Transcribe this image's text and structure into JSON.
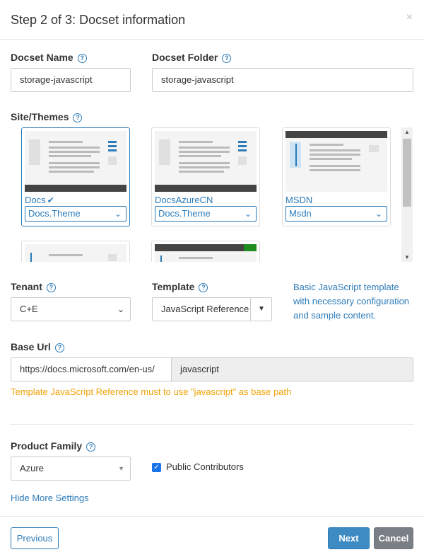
{
  "dialog": {
    "title": "Step 2 of 3: Docset information",
    "close_icon": "×"
  },
  "docset_name": {
    "label": "Docset Name",
    "value": "storage-javascript"
  },
  "docset_folder": {
    "label": "Docset Folder",
    "value": "storage-javascript"
  },
  "themes": {
    "label": "Site/Themes",
    "cards": [
      {
        "name": "Docs",
        "checked_mark": "✔",
        "select": "Docs.Theme",
        "selected": true
      },
      {
        "name": "DocsAzureCN",
        "select": "Docs.Theme"
      },
      {
        "name": "MSDN",
        "select": "Msdn"
      }
    ]
  },
  "tenant": {
    "label": "Tenant",
    "value": "C+E"
  },
  "template": {
    "label": "Template",
    "value": "JavaScript Reference",
    "description": "Basic JavaScript template with necessary configuration and sample content."
  },
  "base_url": {
    "label": "Base Url",
    "prefix": "https://docs.microsoft.com/en-us/",
    "value": "javascript",
    "warning": "Template JavaScript Reference must to use \"javascript\" as base path"
  },
  "product_family": {
    "label": "Product Family",
    "value": "Azure"
  },
  "public_contributors": {
    "label": "Public Contributors",
    "checked": true
  },
  "hide_more_settings": "Hide More Settings",
  "footer": {
    "previous": "Previous",
    "next": "Next",
    "cancel": "Cancel"
  },
  "colors": {
    "accent": "#2b7bb9",
    "warning": "#f0a30a",
    "primary_button": "#3d8bc2",
    "secondary_button": "#7a7f85"
  }
}
